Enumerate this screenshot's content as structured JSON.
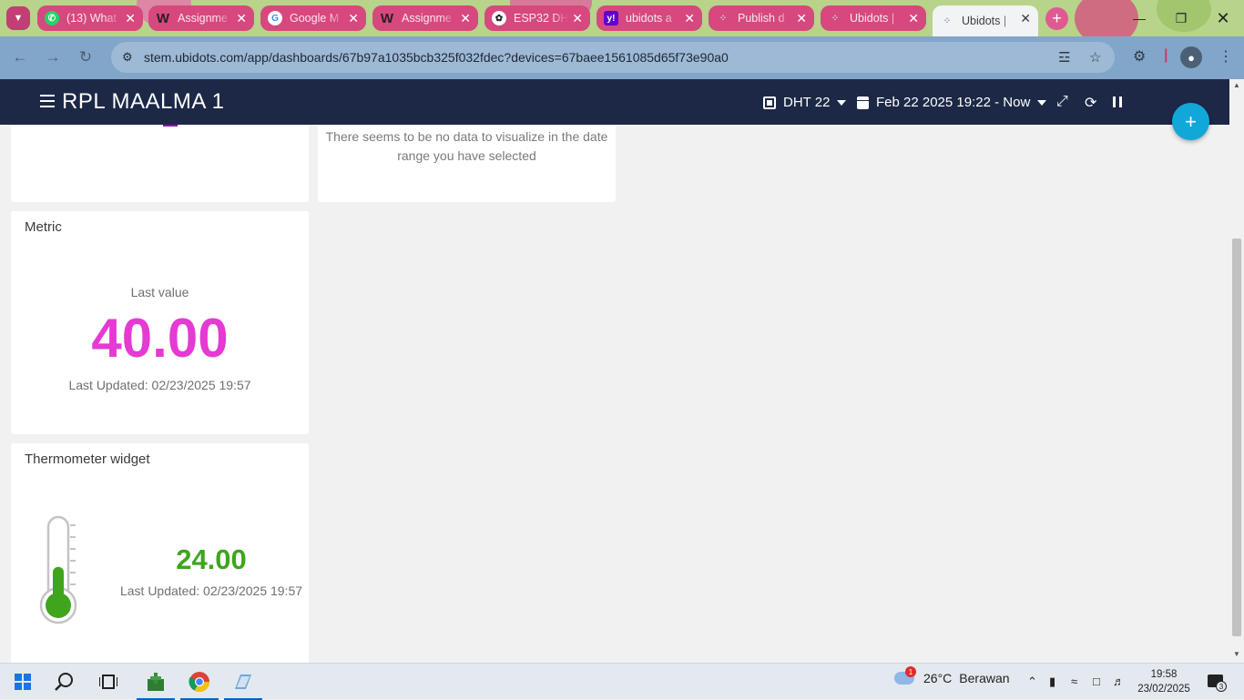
{
  "browser": {
    "tabs": [
      {
        "label": "(13) What",
        "icon": "whatsapp-icon",
        "icon_color": "#25d366"
      },
      {
        "label": "Assignme",
        "icon": "wordwall-icon",
        "icon_color": "#222222"
      },
      {
        "label": "Google M",
        "icon": "google-icon",
        "icon_color": "#4285f4"
      },
      {
        "label": "Assignme",
        "icon": "wordwall-icon",
        "icon_color": "#222222"
      },
      {
        "label": "ESP32 DH",
        "icon": "chatgpt-icon",
        "icon_color": "#222222"
      },
      {
        "label": "ubidots a",
        "icon": "yahoo-icon",
        "icon_color": "#6001d2"
      },
      {
        "label": "Publish d",
        "icon": "ubidots-icon",
        "icon_color": "#9aa7c9"
      },
      {
        "label": "Ubidots |",
        "icon": "ubidots-icon",
        "icon_color": "#9aa7c9"
      },
      {
        "label": "Ubidots |",
        "icon": "ubidots-icon",
        "icon_color": "#9aa7c9",
        "active": true
      }
    ],
    "url": "stem.ubidots.com/app/dashboards/67b97a1035bcb325f032fdec?devices=67baee1561085d65f73e90a0"
  },
  "header": {
    "dashboard_title": "RPL MAALMA 1",
    "device": "DHT 22",
    "date_range": "Feb 22 2025 19:22 - Now"
  },
  "widgets": {
    "nodata": {
      "message": "There seems to be no data to visualize in the date range you have selected"
    },
    "metric": {
      "title": "Metric",
      "label": "Last value",
      "value": "40.00",
      "updated": "Last Updated: 02/23/2025 19:57",
      "color": "#e53ad3"
    },
    "thermometer": {
      "title": "Thermometer widget",
      "value": "24.00",
      "updated": "Last Updated: 02/23/2025 19:57",
      "color": "#3fa51d",
      "fill_fraction": 0.45
    }
  },
  "taskbar": {
    "weather_temp": "26°C",
    "weather_text": "Berawan",
    "weather_badge": "1",
    "time": "19:58",
    "date": "23/02/2025",
    "notifications": "3"
  }
}
